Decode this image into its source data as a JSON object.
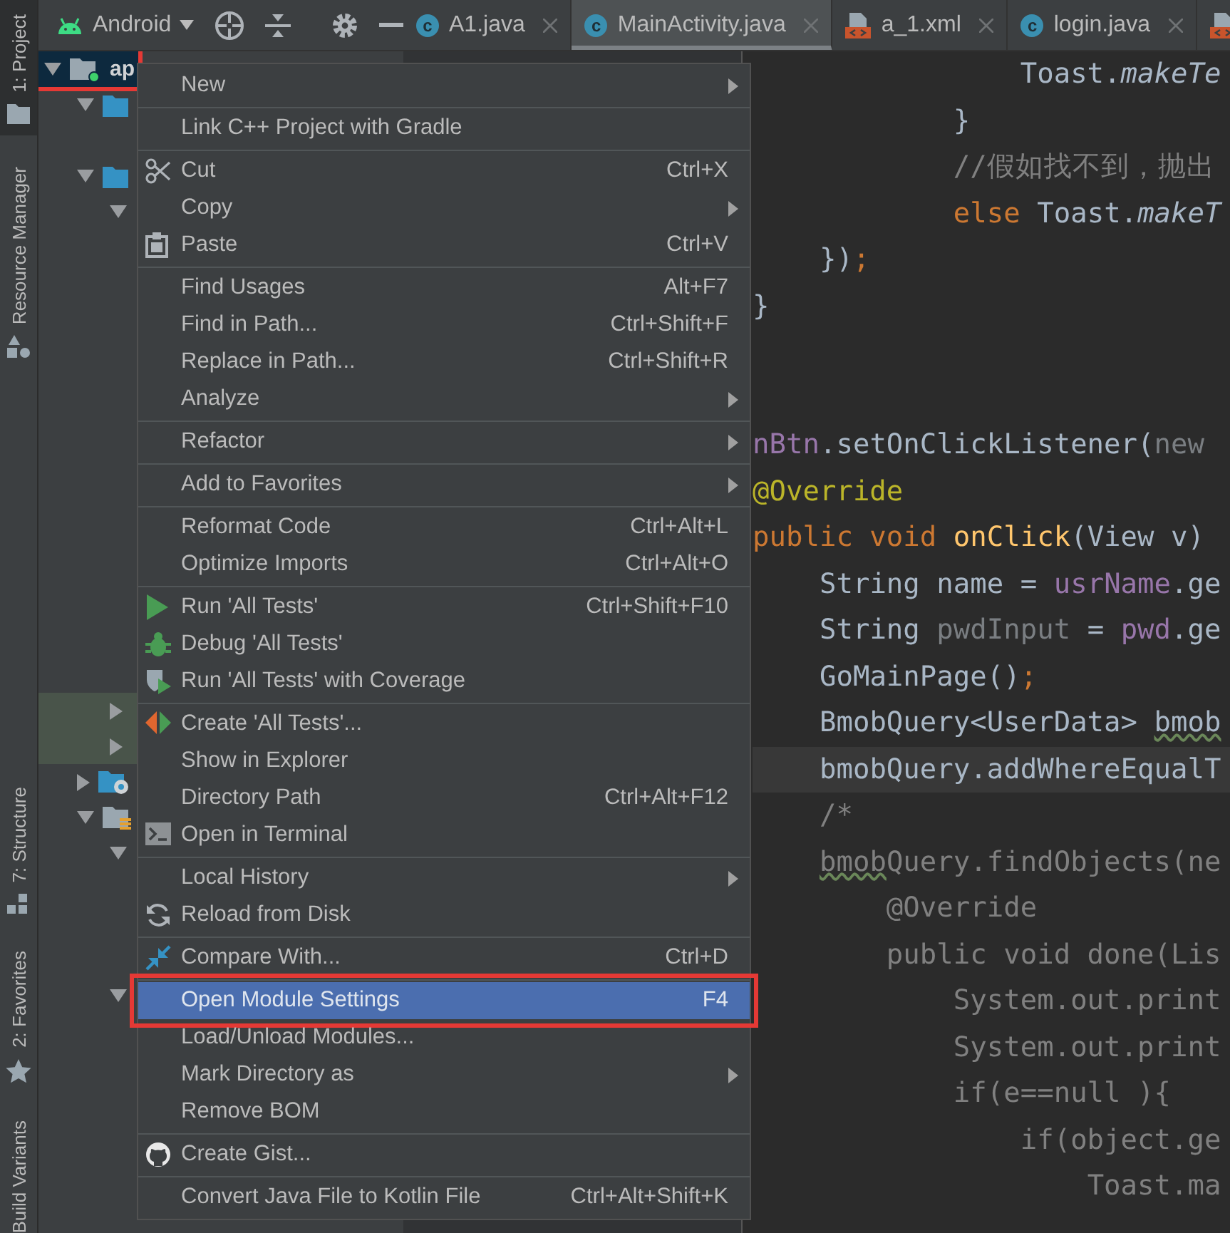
{
  "tool_windows_top": [
    {
      "label": "1: Project",
      "selected": true,
      "kind": "folder"
    },
    {
      "label": "Resource Manager",
      "selected": false,
      "kind": "shapes"
    }
  ],
  "tool_windows_bottom": [
    {
      "label": "7: Structure",
      "selected": false,
      "kind": "structure"
    },
    {
      "label": "2: Favorites",
      "selected": false,
      "kind": "star"
    },
    {
      "label": "Build Variants",
      "selected": false
    }
  ],
  "project_view": {
    "label": "Android"
  },
  "tabs": [
    {
      "label": "A1.java",
      "kind": "class",
      "badge": "c",
      "selected": false
    },
    {
      "label": "MainActivity.java",
      "kind": "class",
      "badge": "c",
      "selected": true
    },
    {
      "label": "a_1.xml",
      "kind": "xml",
      "selected": false
    },
    {
      "label": "login.java",
      "kind": "class",
      "badge": "c",
      "selected": false
    },
    {
      "kind": "xml",
      "selected": false
    }
  ],
  "tree": [
    {
      "label": "ap",
      "kind": "module",
      "expanded": true,
      "selected": true,
      "highlighted": false,
      "framed": true,
      "children": [
        {
          "kind": "folder",
          "expanded": true,
          "selected": false,
          "highlighted": false,
          "framed": false
        },
        {
          "kind": "folder",
          "expanded": true,
          "selected": false,
          "highlighted": false,
          "framed": false,
          "children": [
            {
              "expanded": true,
              "selected": false,
              "highlighted": false,
              "framed": false
            },
            {
              "expanded": false,
              "selected": false,
              "highlighted": true,
              "framed": false
            },
            {
              "expanded": false,
              "selected": false,
              "highlighted": true,
              "framed": false
            }
          ]
        },
        {
          "kind": "folder-gear",
          "expanded": false,
          "selected": false,
          "highlighted": false,
          "framed": false
        },
        {
          "kind": "folder-res",
          "expanded": true,
          "selected": false,
          "highlighted": false,
          "framed": false,
          "children": [
            {
              "expanded": true,
              "selected": false,
              "highlighted": false,
              "framed": false
            },
            {
              "expanded": true,
              "selected": false,
              "highlighted": false,
              "framed": false
            }
          ]
        }
      ]
    }
  ],
  "code": [
    {
      "current": false,
      "parts": [
        {
          "text": "                Toast.",
          "kind": "plain"
        },
        {
          "text": "makeTe",
          "kind": "static"
        }
      ]
    },
    {
      "current": false,
      "parts": [
        {
          "text": "            }",
          "kind": "plain"
        }
      ]
    },
    {
      "current": false,
      "parts": [
        {
          "text": "            //假如找不到，抛出",
          "kind": "comment"
        }
      ]
    },
    {
      "current": false,
      "parts": [
        {
          "text": "            else",
          "kind": "keyword"
        },
        {
          "text": " Toast.",
          "kind": "plain"
        },
        {
          "text": "makeT",
          "kind": "static"
        }
      ]
    },
    {
      "current": false,
      "parts": [
        {
          "text": "    })",
          "kind": "plain"
        },
        {
          "text": ";",
          "kind": "keyword"
        }
      ]
    },
    {
      "current": false,
      "parts": [
        {
          "text": "}",
          "kind": "plain"
        }
      ]
    },
    {
      "current": false
    },
    {
      "current": false
    },
    {
      "current": false,
      "parts": [
        {
          "text": "nBtn",
          "kind": "field"
        },
        {
          "text": ".setOnClickListener(",
          "kind": "plain"
        },
        {
          "text": "new",
          "kind": "unused"
        }
      ]
    },
    {
      "current": false,
      "parts": [
        {
          "text": "@Override",
          "kind": "annotation"
        }
      ]
    },
    {
      "current": false,
      "parts": [
        {
          "text": "public void ",
          "kind": "keyword"
        },
        {
          "text": "onClick",
          "kind": "decl"
        },
        {
          "text": "(View v)",
          "kind": "plain"
        }
      ]
    },
    {
      "current": false,
      "parts": [
        {
          "text": "    String name = ",
          "kind": "plain"
        },
        {
          "text": "usrName",
          "kind": "field"
        },
        {
          "text": ".ge",
          "kind": "plain"
        }
      ]
    },
    {
      "current": false,
      "parts": [
        {
          "text": "    String ",
          "kind": "plain"
        },
        {
          "text": "pwdInput",
          "kind": "unused"
        },
        {
          "text": " = ",
          "kind": "plain"
        },
        {
          "text": "pwd",
          "kind": "field"
        },
        {
          "text": ".ge",
          "kind": "plain"
        }
      ]
    },
    {
      "current": false,
      "parts": [
        {
          "text": "    GoMainPage()",
          "kind": "plain"
        },
        {
          "text": ";",
          "kind": "keyword"
        }
      ]
    },
    {
      "current": false,
      "parts": [
        {
          "text": "    BmobQuery<UserData> ",
          "kind": "plain"
        },
        {
          "text": "bmob",
          "kind": "plain",
          "warning": true
        }
      ]
    },
    {
      "current": true,
      "parts": [
        {
          "text": "    bmobQuery.addWhereEqualT",
          "kind": "plain"
        }
      ]
    },
    {
      "current": false,
      "parts": [
        {
          "text": "    /*",
          "kind": "comment"
        }
      ]
    },
    {
      "current": false,
      "parts": [
        {
          "text": "    bmob",
          "kind": "comment",
          "warning": true
        },
        {
          "text": "Query.findObjects(ne",
          "kind": "comment"
        }
      ]
    },
    {
      "current": false,
      "parts": [
        {
          "text": "        @Override",
          "kind": "comment"
        }
      ]
    },
    {
      "current": false,
      "parts": [
        {
          "text": "        public void done(Lis",
          "kind": "comment"
        }
      ]
    },
    {
      "current": false,
      "parts": [
        {
          "text": "            System.out.print",
          "kind": "comment"
        }
      ]
    },
    {
      "current": false,
      "parts": [
        {
          "text": "            System.out.print",
          "kind": "comment"
        }
      ]
    },
    {
      "current": false,
      "parts": [
        {
          "text": "            if(e==null ){",
          "kind": "comment"
        }
      ]
    },
    {
      "current": false,
      "parts": [
        {
          "text": "                if(object.ge",
          "kind": "comment"
        }
      ]
    },
    {
      "current": false,
      "parts": [
        {
          "text": "                    Toast.ma",
          "kind": "comment"
        }
      ]
    }
  ],
  "context_menu": {
    "groups": [
      [
        {
          "label": "New",
          "submenu": true,
          "selected": false,
          "framed": false
        }
      ],
      [
        {
          "label": "Link C++ Project with Gradle",
          "submenu": false,
          "selected": false,
          "framed": false
        }
      ],
      [
        {
          "label": "Cut",
          "shortcut": "Ctrl+X",
          "kind": "scissors",
          "submenu": false,
          "selected": false,
          "framed": false
        },
        {
          "label": "Copy",
          "submenu": true,
          "selected": false,
          "framed": false
        },
        {
          "label": "Paste",
          "shortcut": "Ctrl+V",
          "kind": "clipboard",
          "submenu": false,
          "selected": false,
          "framed": false
        }
      ],
      [
        {
          "label": "Find Usages",
          "shortcut": "Alt+F7",
          "submenu": false,
          "selected": false,
          "framed": false
        },
        {
          "label": "Find in Path...",
          "shortcut": "Ctrl+Shift+F",
          "submenu": false,
          "selected": false,
          "framed": false
        },
        {
          "label": "Replace in Path...",
          "shortcut": "Ctrl+Shift+R",
          "submenu": false,
          "selected": false,
          "framed": false
        },
        {
          "label": "Analyze",
          "submenu": true,
          "selected": false,
          "framed": false
        }
      ],
      [
        {
          "label": "Refactor",
          "submenu": true,
          "selected": false,
          "framed": false
        }
      ],
      [
        {
          "label": "Add to Favorites",
          "submenu": true,
          "selected": false,
          "framed": false
        }
      ],
      [
        {
          "label": "Reformat Code",
          "shortcut": "Ctrl+Alt+L",
          "submenu": false,
          "selected": false,
          "framed": false
        },
        {
          "label": "Optimize Imports",
          "shortcut": "Ctrl+Alt+O",
          "submenu": false,
          "selected": false,
          "framed": false
        }
      ],
      [
        {
          "label": "Run 'All Tests'",
          "shortcut": "Ctrl+Shift+F10",
          "kind": "run",
          "submenu": false,
          "selected": false,
          "framed": false
        },
        {
          "label": "Debug 'All Tests'",
          "kind": "bug",
          "submenu": false,
          "selected": false,
          "framed": false
        },
        {
          "label": "Run 'All Tests' with Coverage",
          "kind": "coverage",
          "submenu": false,
          "selected": false,
          "framed": false
        }
      ],
      [
        {
          "label": "Create 'All Tests'...",
          "kind": "create-test",
          "submenu": false,
          "selected": false,
          "framed": false
        },
        {
          "label": "Show in Explorer",
          "submenu": false,
          "selected": false,
          "framed": false
        },
        {
          "label": "Directory Path",
          "shortcut": "Ctrl+Alt+F12",
          "submenu": false,
          "selected": false,
          "framed": false
        },
        {
          "label": "Open in Terminal",
          "kind": "terminal",
          "submenu": false,
          "selected": false,
          "framed": false
        }
      ],
      [
        {
          "label": "Local History",
          "submenu": true,
          "selected": false,
          "framed": false
        },
        {
          "label": "Reload from Disk",
          "kind": "reload",
          "submenu": false,
          "selected": false,
          "framed": false
        }
      ],
      [
        {
          "label": "Compare With...",
          "shortcut": "Ctrl+D",
          "kind": "compare",
          "submenu": false,
          "selected": false,
          "framed": false
        }
      ],
      [
        {
          "label": "Open Module Settings",
          "shortcut": "F4",
          "submenu": false,
          "selected": true,
          "framed": true
        },
        {
          "label": "Load/Unload Modules...",
          "submenu": false,
          "selected": false,
          "framed": false
        },
        {
          "label": "Mark Directory as",
          "submenu": true,
          "selected": false,
          "framed": false
        },
        {
          "label": "Remove BOM",
          "submenu": false,
          "selected": false,
          "framed": false
        }
      ],
      [
        {
          "label": "Create Gist...",
          "kind": "github",
          "submenu": false,
          "selected": false,
          "framed": false
        }
      ],
      [
        {
          "label": "Convert Java File to Kotlin File",
          "shortcut": "Ctrl+Alt+Shift+K",
          "submenu": false,
          "selected": false,
          "framed": false
        }
      ]
    ]
  }
}
